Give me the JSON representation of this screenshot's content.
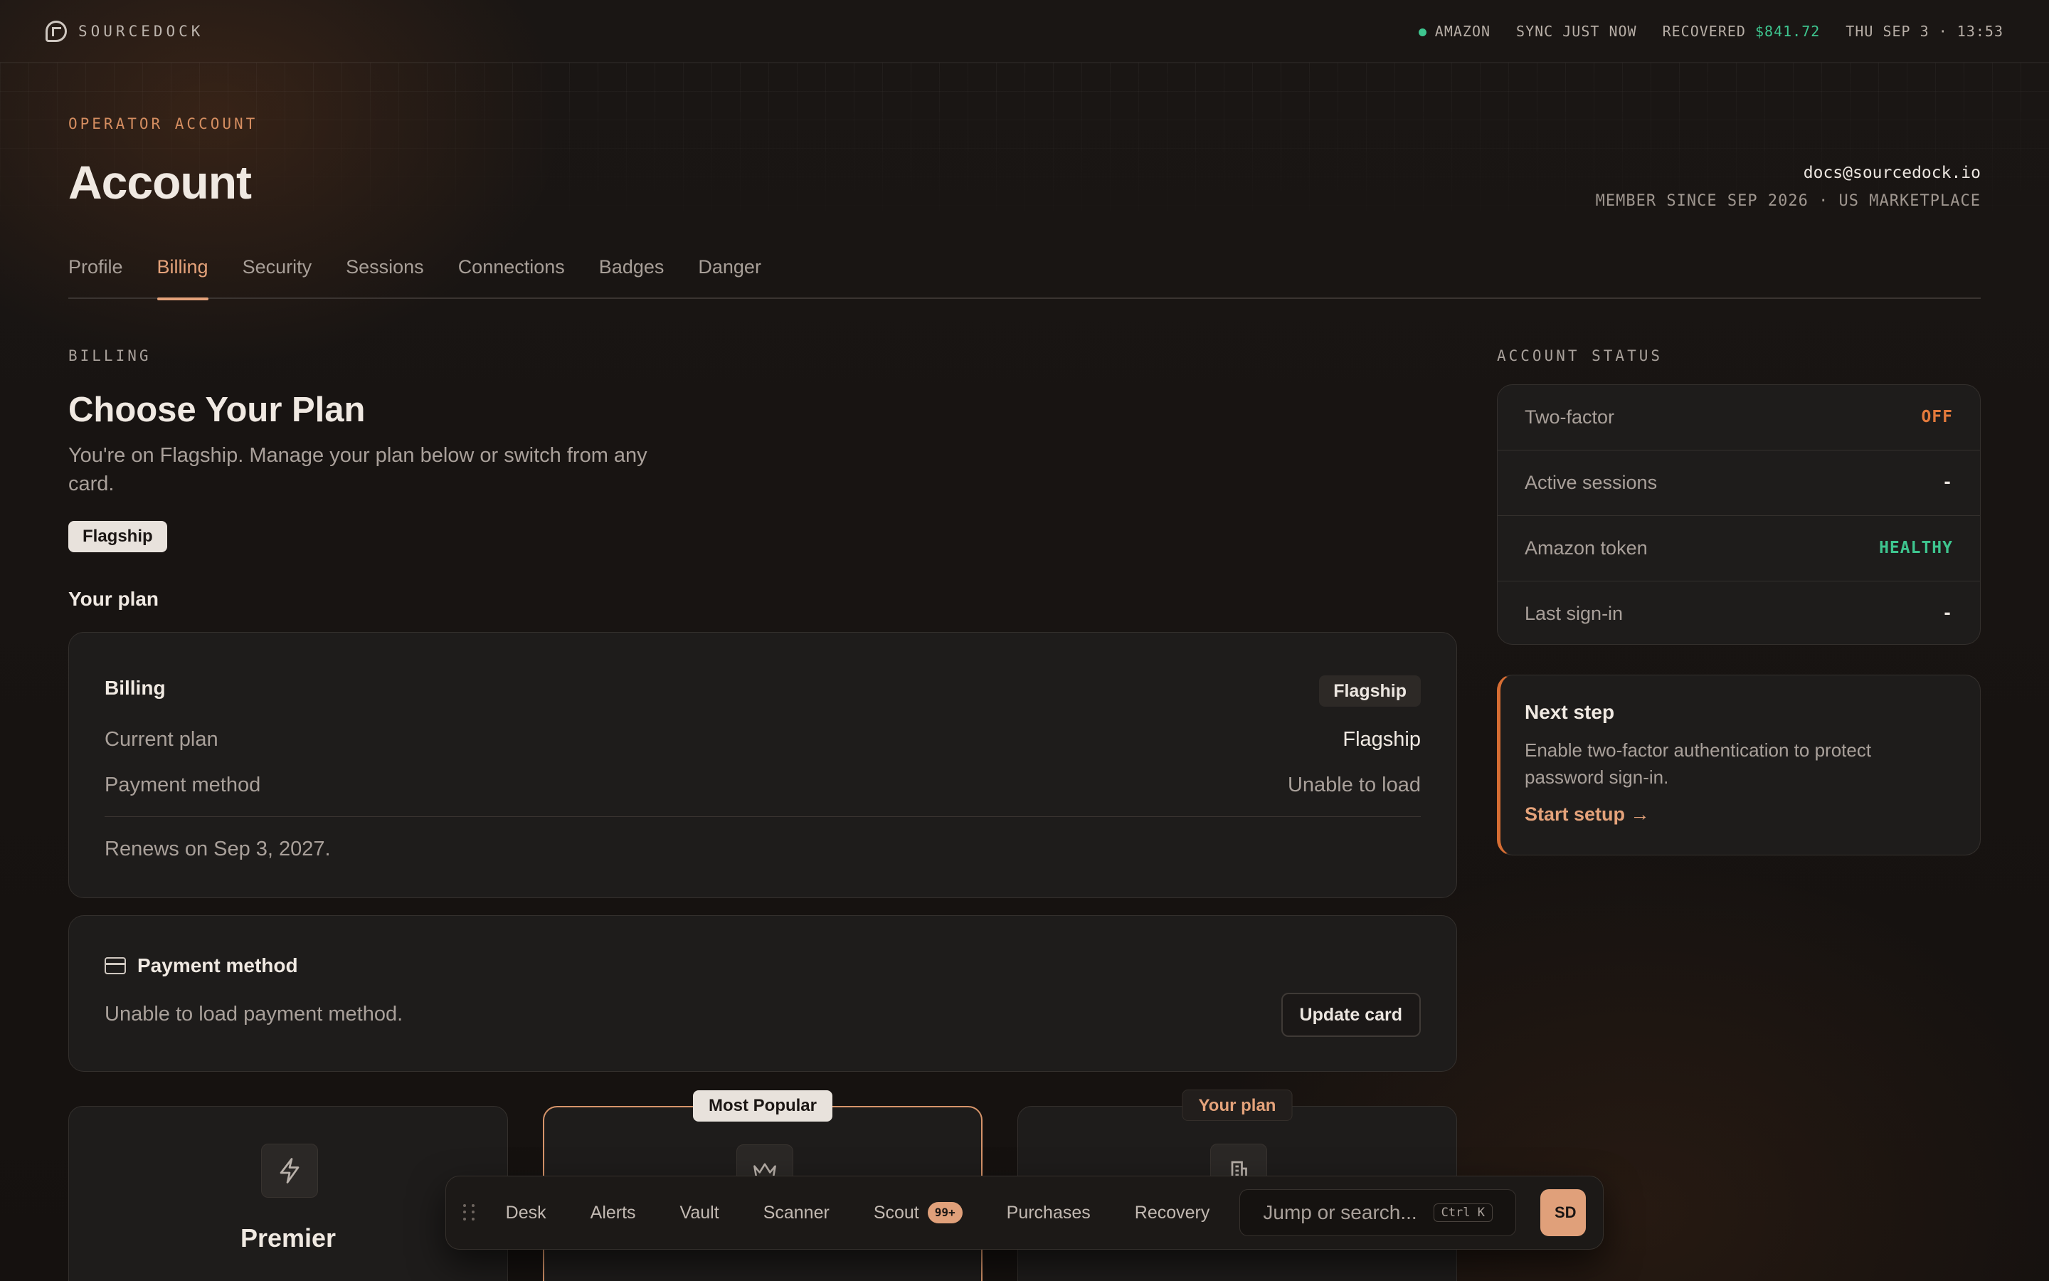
{
  "brand": {
    "name": "SOURCEDOCK",
    "logo_icon": "sd-logo-icon"
  },
  "topbar": {
    "marketplace": "AMAZON",
    "sync": "SYNC JUST NOW",
    "recovered_label": "RECOVERED",
    "recovered_value": "$841.72",
    "datetime": "THU SEP 3 · 13:53"
  },
  "header": {
    "eyebrow": "OPERATOR ACCOUNT",
    "title": "Account",
    "email": "docs@sourcedock.io",
    "member_since": "MEMBER SINCE SEP 2026 · US MARKETPLACE"
  },
  "tabs": [
    "Profile",
    "Billing",
    "Security",
    "Sessions",
    "Connections",
    "Badges",
    "Danger"
  ],
  "active_tab": "Billing",
  "billing": {
    "section_label": "BILLING",
    "heading": "Choose Your Plan",
    "subtext": "You're on Flagship. Manage your plan below or switch from any card.",
    "current_pill": "Flagship",
    "your_plan_label": "Your plan",
    "card": {
      "title": "Billing",
      "plan_pill": "Flagship",
      "current_plan_label": "Current plan",
      "current_plan_value": "Flagship",
      "payment_method_label": "Payment method",
      "payment_method_value": "Unable to load",
      "renews": "Renews on Sep 3, 2027."
    },
    "payment": {
      "title": "Payment method",
      "message": "Unable to load payment method.",
      "button": "Update card"
    },
    "plans": [
      {
        "name": "Premier",
        "icon": "lightning-icon",
        "tag": ""
      },
      {
        "name": "",
        "icon": "crown-icon",
        "tag": "Most Popular"
      },
      {
        "name": "",
        "icon": "building-icon",
        "tag": "Your plan"
      }
    ]
  },
  "status": {
    "section_label": "ACCOUNT STATUS",
    "rows": [
      {
        "label": "Two-factor",
        "value": "OFF",
        "color": "#e37a3c"
      },
      {
        "label": "Active sessions",
        "value": "-",
        "color": "#ece6e0"
      },
      {
        "label": "Amazon token",
        "value": "HEALTHY",
        "color": "#3ec58f"
      },
      {
        "label": "Last sign-in",
        "value": "-",
        "color": "#ece6e0"
      }
    ]
  },
  "next_step": {
    "title": "Next step",
    "text": "Enable two-factor authentication to protect password sign-in.",
    "link": "Start setup →"
  },
  "dock": {
    "items": [
      "Desk",
      "Alerts",
      "Vault",
      "Scanner",
      "Scout",
      "Purchases",
      "Recovery"
    ],
    "scout_badge": "99+",
    "search_placeholder": "Jump or search...",
    "shortcut": "Ctrl K",
    "avatar": "SD"
  },
  "colors": {
    "accent": "#e4a27a",
    "success": "#3ec58f",
    "warning": "#e37a3c"
  }
}
